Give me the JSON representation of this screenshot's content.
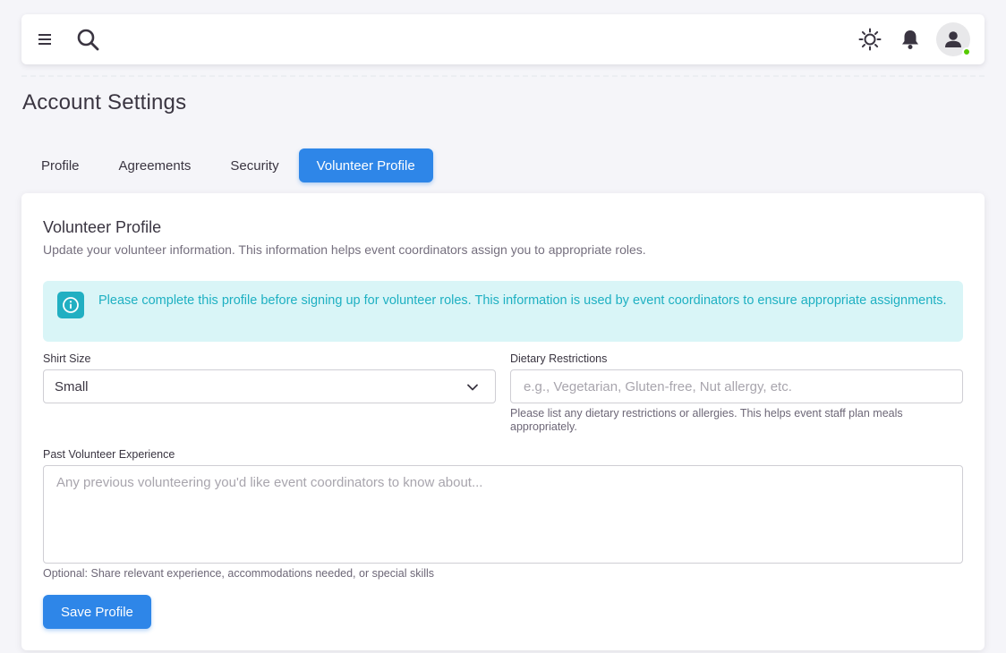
{
  "header": {
    "icons": [
      "menu-icon",
      "search-icon",
      "sun-icon",
      "bell-icon",
      "user-icon"
    ],
    "status_color": "#56ca00"
  },
  "page": {
    "title": "Account Settings"
  },
  "tabs": [
    {
      "label": "Profile",
      "active": false
    },
    {
      "label": "Agreements",
      "active": false
    },
    {
      "label": "Security",
      "active": false
    },
    {
      "label": "Volunteer Profile",
      "active": true
    }
  ],
  "card": {
    "title": "Volunteer Profile",
    "subtitle": "Update your volunteer information. This information helps event coordinators assign you to appropriate roles.",
    "alert": {
      "icon": "info-icon",
      "text": "Please complete this profile before signing up for volunteer roles. This information is used by event coordinators to ensure appropriate assignments."
    },
    "shirt_size": {
      "label": "Shirt Size",
      "value": "Small"
    },
    "dietary": {
      "label": "Dietary Restrictions",
      "placeholder": "e.g., Vegetarian, Gluten-free, Nut allergy, etc.",
      "help": "Please list any dietary restrictions or allergies. This helps event staff plan meals appropriately."
    },
    "experience": {
      "label": "Past Volunteer Experience",
      "placeholder": "Any previous volunteering you'd like event coordinators to know about...",
      "help": "Optional: Share relevant experience, accommodations needed, or special skills"
    },
    "save_label": "Save Profile"
  },
  "colors": {
    "primary": "#2e86e8",
    "info": "#21afc2",
    "info_bg": "#d9f5f7"
  }
}
